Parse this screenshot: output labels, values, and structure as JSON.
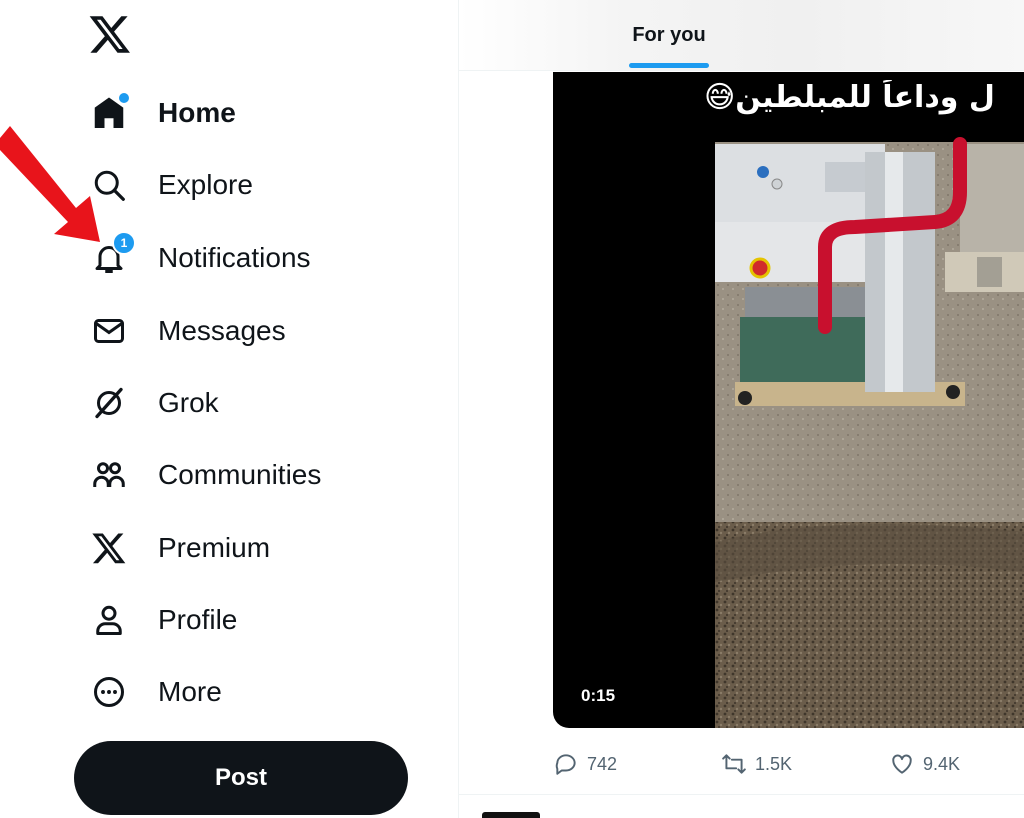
{
  "sidebar": {
    "items": [
      {
        "label": "Home",
        "icon": "home-icon"
      },
      {
        "label": "Explore",
        "icon": "search-icon"
      },
      {
        "label": "Notifications",
        "icon": "bell-icon",
        "badge": "1"
      },
      {
        "label": "Messages",
        "icon": "envelope-icon"
      },
      {
        "label": "Grok",
        "icon": "grok-icon"
      },
      {
        "label": "Communities",
        "icon": "people-icon"
      },
      {
        "label": "Premium",
        "icon": "x-logo-icon"
      },
      {
        "label": "Profile",
        "icon": "person-icon"
      },
      {
        "label": "More",
        "icon": "more-circle-icon"
      }
    ],
    "post_label": "Post"
  },
  "header": {
    "tab_label": "For you"
  },
  "tweet": {
    "video_caption": "ل وداعاً للمبلطين😅",
    "video_duration": "0:15",
    "replies": "742",
    "reposts": "1.5K",
    "likes": "9.4K"
  },
  "colors": {
    "accent": "#1d9bf0",
    "text": "#0f1419",
    "muted": "#536471",
    "annotation_arrow": "#e8141b"
  }
}
